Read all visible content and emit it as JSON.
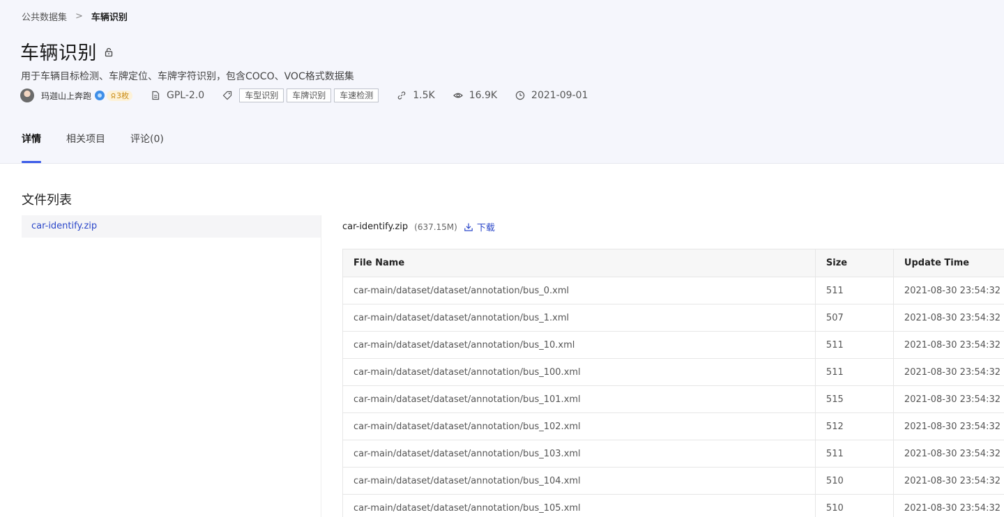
{
  "breadcrumb": {
    "parent": "公共数据集",
    "separator": ">",
    "current": "车辆识别"
  },
  "dataset": {
    "title": "车辆识别",
    "description": "用于车辆目标检测、车牌定位、车牌字符识别，包含COCO、VOC格式数据集",
    "author": "玛迦山上奔跑",
    "badge": "3枚",
    "license": "GPL-2.0",
    "tags": [
      "车型识别",
      "车牌识别",
      "车速检测"
    ],
    "forks": "1.5K",
    "views": "16.9K",
    "date": "2021-09-01"
  },
  "tabs": [
    {
      "label": "详情",
      "active": true
    },
    {
      "label": "相关项目",
      "active": false
    },
    {
      "label": "评论(0)",
      "active": false
    }
  ],
  "files": {
    "section_title": "文件列表",
    "items": [
      "car-identify.zip"
    ],
    "selected": {
      "name": "car-identify.zip",
      "size": "(637.15M)",
      "download_label": "下载"
    }
  },
  "table": {
    "headers": [
      "File Name",
      "Size",
      "Update Time"
    ],
    "rows": [
      [
        "car-main/dataset/dataset/annotation/bus_0.xml",
        "511",
        "2021-08-30 23:54:32"
      ],
      [
        "car-main/dataset/dataset/annotation/bus_1.xml",
        "507",
        "2021-08-30 23:54:32"
      ],
      [
        "car-main/dataset/dataset/annotation/bus_10.xml",
        "511",
        "2021-08-30 23:54:32"
      ],
      [
        "car-main/dataset/dataset/annotation/bus_100.xml",
        "511",
        "2021-08-30 23:54:32"
      ],
      [
        "car-main/dataset/dataset/annotation/bus_101.xml",
        "515",
        "2021-08-30 23:54:32"
      ],
      [
        "car-main/dataset/dataset/annotation/bus_102.xml",
        "512",
        "2021-08-30 23:54:32"
      ],
      [
        "car-main/dataset/dataset/annotation/bus_103.xml",
        "511",
        "2021-08-30 23:54:32"
      ],
      [
        "car-main/dataset/dataset/annotation/bus_104.xml",
        "510",
        "2021-08-30 23:54:32"
      ],
      [
        "car-main/dataset/dataset/annotation/bus_105.xml",
        "510",
        "2021-08-30 23:54:32"
      ]
    ]
  },
  "colors": {
    "accent": "#3a5ae8",
    "link": "#2b47c9",
    "header_bg": "#f5f6fc"
  }
}
